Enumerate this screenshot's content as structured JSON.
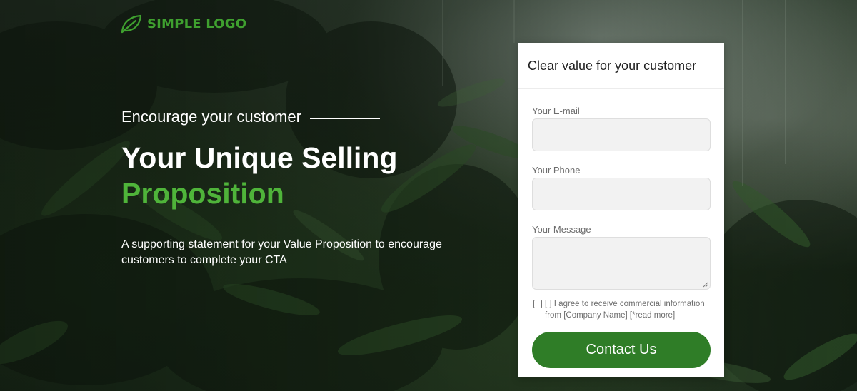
{
  "brand": {
    "logo_text": "SIMPLE LOGO",
    "logo_icon": "leaf-icon",
    "accent_color": "#3fa02f"
  },
  "hero": {
    "kicker": "Encourage your customer",
    "headline_line1": "Your Unique Selling",
    "headline_line2": "Proposition",
    "supporting_text": "A supporting statement for your Value Proposition to encourage customers to complete your CTA"
  },
  "form": {
    "title": "Clear value for your customer",
    "fields": [
      {
        "label": "Your E-mail",
        "value": ""
      },
      {
        "label": "Your Phone",
        "value": ""
      },
      {
        "label": "Your Message",
        "value": ""
      }
    ],
    "consent_text": "[ ] I agree to receive commercial information from [Company Name] [*read more]",
    "consent_checked": false,
    "submit_label": "Contact Us",
    "submit_color": "#2f7d27"
  }
}
